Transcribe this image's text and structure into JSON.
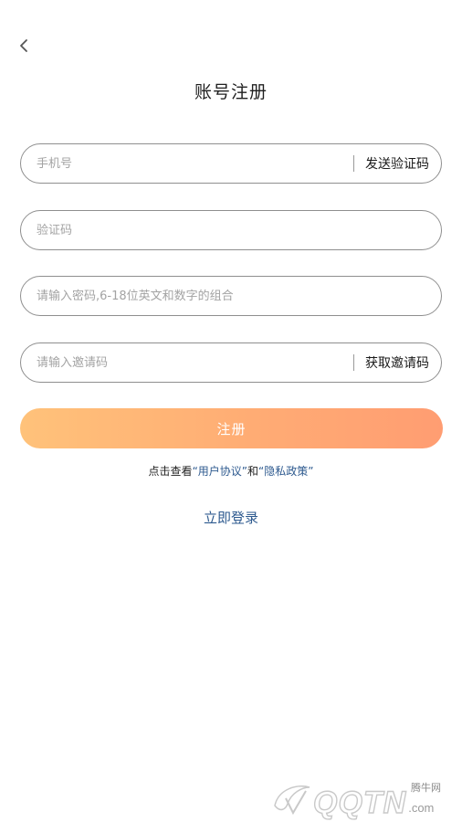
{
  "header": {
    "title": "账号注册",
    "back_icon": "chevron-left-icon"
  },
  "form": {
    "phone": {
      "placeholder": "手机号",
      "action_label": "发送验证码"
    },
    "code": {
      "placeholder": "验证码"
    },
    "password": {
      "placeholder": "请输入密码,6-18位英文和数字的组合"
    },
    "invite": {
      "placeholder": "请输入邀请码",
      "action_label": "获取邀请码"
    }
  },
  "register_button": {
    "label": "注册"
  },
  "agreement": {
    "prefix": "点击查看",
    "user_agreement": "“用户协议”",
    "conjunction": "和",
    "privacy_policy": "“隐私政策”"
  },
  "login_link": {
    "label": "立即登录"
  },
  "watermark": {
    "site_cn": "腾牛网",
    "logo_text": "QQTN",
    "domain_suffix": ".com"
  },
  "colors": {
    "link": "#2e5a8f",
    "button_gradient_start": "#ffc27a",
    "button_gradient_end": "#ff9d72",
    "field_border": "#8f8f8f"
  }
}
